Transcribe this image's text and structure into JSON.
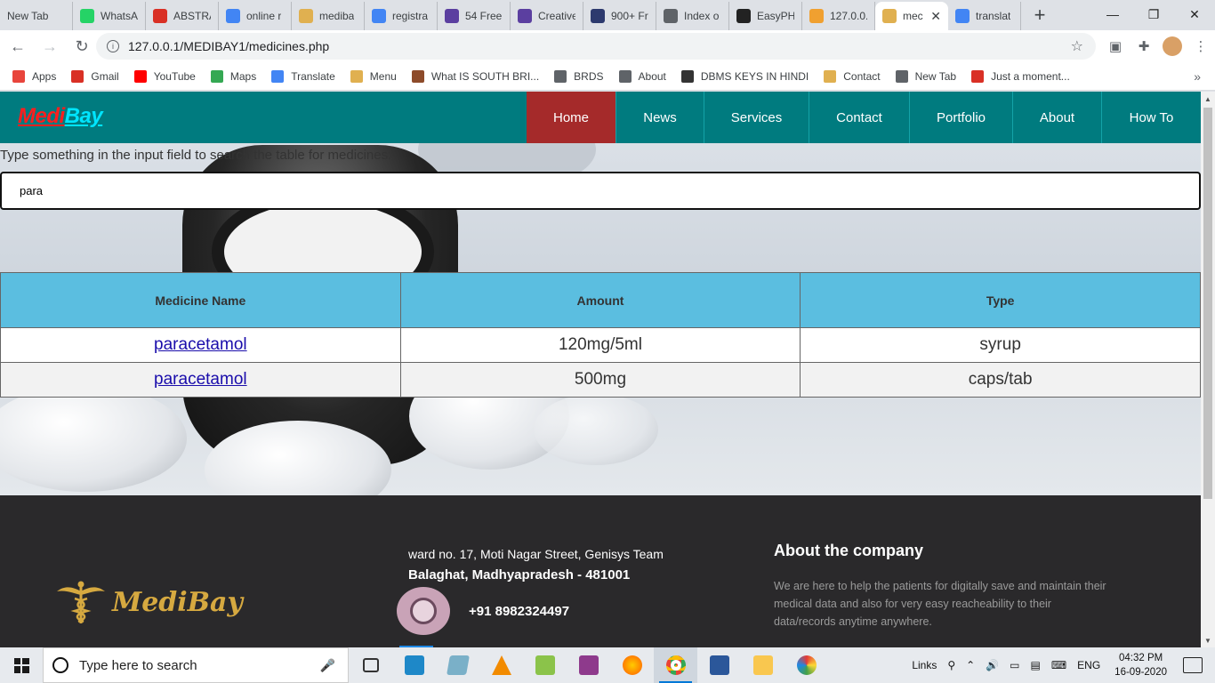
{
  "browser": {
    "tabs": [
      {
        "title": "New Tab",
        "icon": "blank",
        "color": "#dee1e6"
      },
      {
        "title": "WhatsA",
        "icon": "whatsapp-icon",
        "color": "#25d366"
      },
      {
        "title": "ABSTRA",
        "icon": "gmail-icon",
        "color": "#d93025"
      },
      {
        "title": "online r",
        "icon": "google-icon",
        "color": "#4285f4"
      },
      {
        "title": "mediba",
        "icon": "medibay-icon",
        "color": "#e0b050"
      },
      {
        "title": "registra",
        "icon": "google-icon",
        "color": "#4285f4"
      },
      {
        "title": "54 Free",
        "icon": "colorlib-icon",
        "color": "#5b3fa0"
      },
      {
        "title": "Creative",
        "icon": "colorlib-icon",
        "color": "#5b3fa0"
      },
      {
        "title": "900+ Fr",
        "icon": "w3layouts-icon",
        "color": "#2d3a6e"
      },
      {
        "title": "Index o",
        "icon": "globe-icon",
        "color": "#5f6368"
      },
      {
        "title": "EasyPH",
        "icon": "easyphp-icon",
        "color": "#222222"
      },
      {
        "title": "127.0.0.",
        "icon": "phpmyadmin-icon",
        "color": "#f0a030"
      },
      {
        "title": "mec",
        "icon": "medibay-icon",
        "color": "#e0b050",
        "active": true
      },
      {
        "title": "translat",
        "icon": "google-icon",
        "color": "#4285f4"
      }
    ],
    "url": "127.0.0.1/MEDIBAY1/medicines.php",
    "bookmarks": [
      {
        "label": "Apps",
        "icon": "apps-grid-icon",
        "color": "#e8453c"
      },
      {
        "label": "Gmail",
        "icon": "gmail-icon",
        "color": "#d93025"
      },
      {
        "label": "YouTube",
        "icon": "youtube-icon",
        "color": "#ff0000"
      },
      {
        "label": "Maps",
        "icon": "maps-icon",
        "color": "#34a853"
      },
      {
        "label": "Translate",
        "icon": "translate-icon",
        "color": "#4285f4"
      },
      {
        "label": "Menu",
        "icon": "medibay-icon",
        "color": "#e0b050"
      },
      {
        "label": "What IS SOUTH BRI...",
        "icon": "image-icon",
        "color": "#8d4b2a"
      },
      {
        "label": "BRDS",
        "icon": "globe-icon",
        "color": "#5f6368"
      },
      {
        "label": "About",
        "icon": "globe-icon",
        "color": "#5f6368"
      },
      {
        "label": "DBMS KEYS IN HINDI",
        "icon": "link-icon",
        "color": "#333333"
      },
      {
        "label": "Contact",
        "icon": "medibay-icon",
        "color": "#e0b050"
      },
      {
        "label": "New Tab",
        "icon": "globe-icon",
        "color": "#5f6368"
      },
      {
        "label": "Just a moment...",
        "icon": "cloudflare-icon",
        "color": "#d93025"
      }
    ]
  },
  "site": {
    "logo_part1": "Medi",
    "logo_part2": "Bay",
    "nav": [
      {
        "label": "Home",
        "active": true
      },
      {
        "label": "News"
      },
      {
        "label": "Services"
      },
      {
        "label": "Contact"
      },
      {
        "label": "Portfolio"
      },
      {
        "label": "About"
      },
      {
        "label": "How To"
      }
    ],
    "search_hint": "Type something in the input field to search the table for medicines:",
    "search_value": "para",
    "table": {
      "headers": [
        "Medicine Name",
        "Amount",
        "Type"
      ],
      "rows": [
        {
          "name": "paracetamol",
          "amount": "120mg/5ml",
          "type": "syrup"
        },
        {
          "name": "paracetamol",
          "amount": "500mg",
          "type": "caps/tab"
        }
      ]
    },
    "footer": {
      "logo_text": "MediBay",
      "address_line1": "ward no. 17, Moti Nagar Street, Genisys Team",
      "address_line2": "Balaghat, Madhyapradesh - 481001",
      "phone": "+91 8982324497",
      "about_title": "About the company",
      "about_text": "We are here to help the patients for digitally save and maintain their medical data and also for very easy reacheability to their data/records anytime anywhere."
    }
  },
  "taskbar": {
    "search_placeholder": "Type here to search",
    "tray_links": "Links",
    "language": "ENG",
    "time": "04:32 PM",
    "date": "16-09-2020"
  },
  "colors": {
    "header_bg": "#007b7f",
    "nav_active": "#a52a2a",
    "table_header": "#5bbee0",
    "footer_bg": "#2a292b"
  }
}
